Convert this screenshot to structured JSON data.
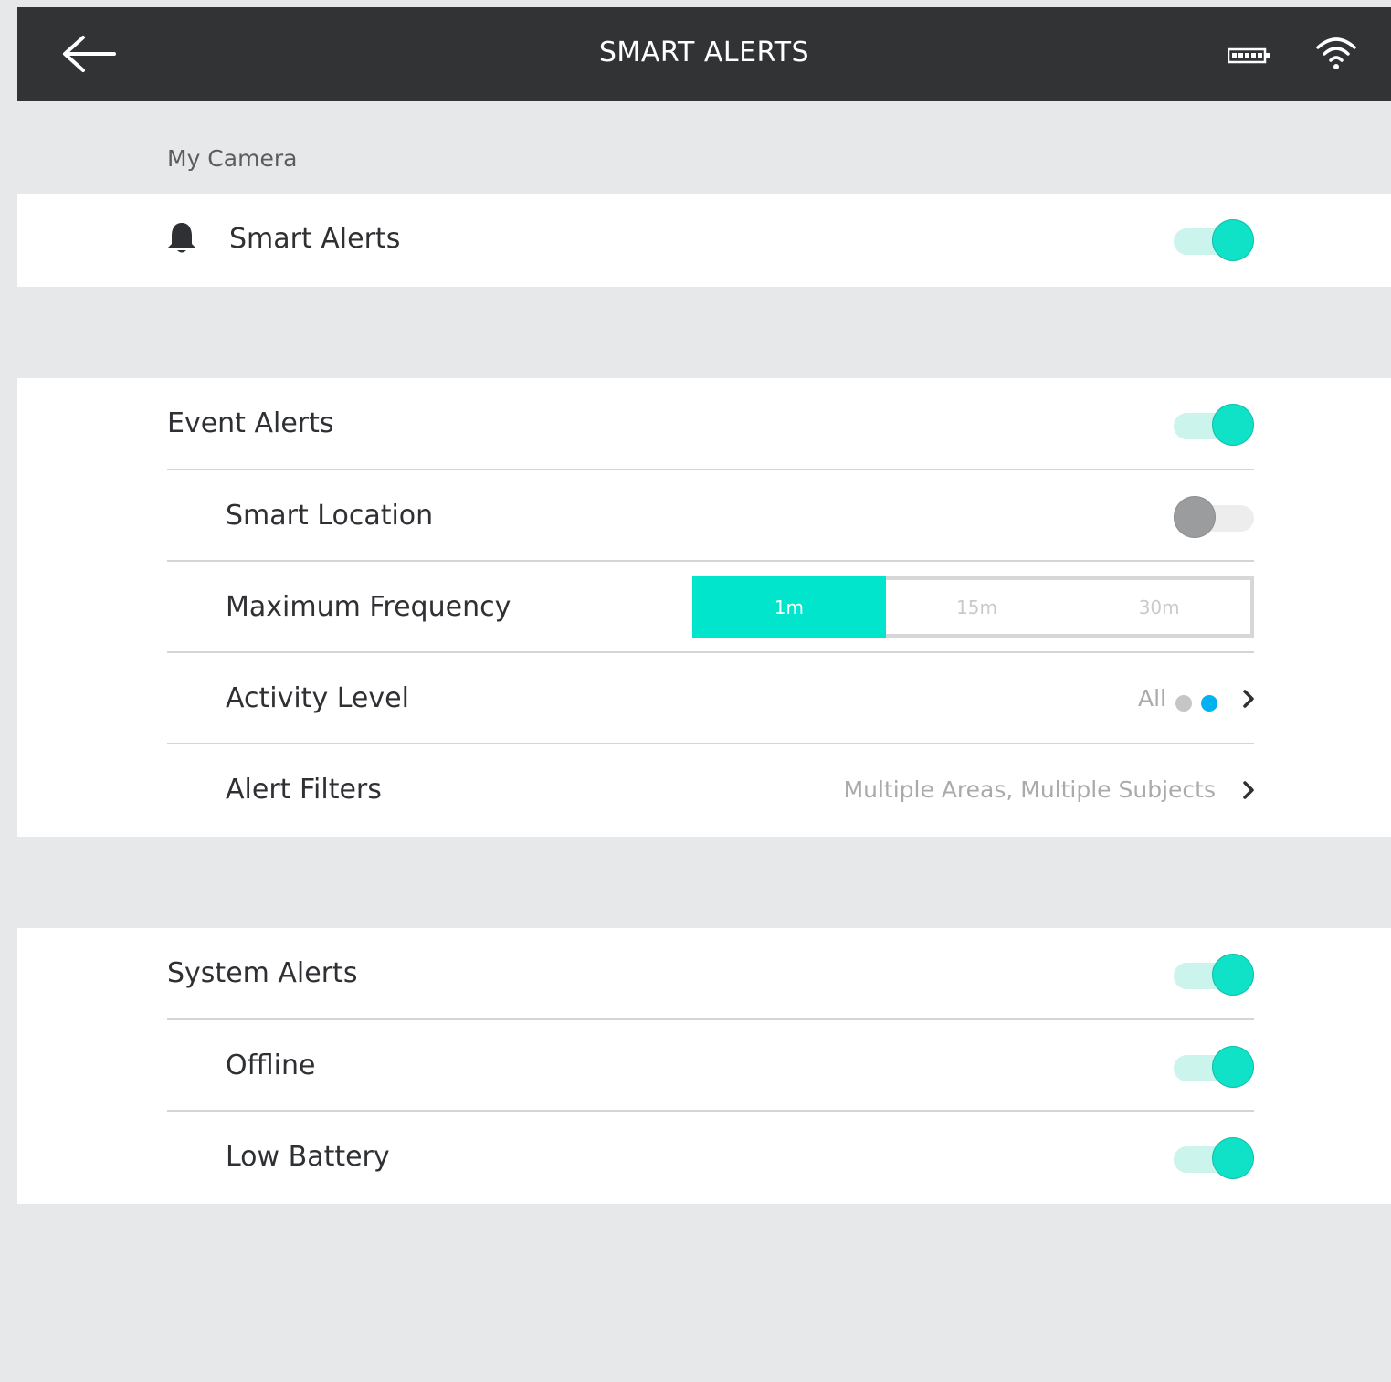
{
  "header": {
    "title": "SMART ALERTS",
    "back_icon": "arrow-left-icon",
    "battery_icon": "battery-icon",
    "wifi_icon": "wifi-icon"
  },
  "section": {
    "label": "My Camera"
  },
  "smart_alerts": {
    "label": "Smart Alerts",
    "icon": "bell-icon",
    "enabled": true
  },
  "event_alerts": {
    "label": "Event Alerts",
    "enabled": true,
    "smart_location": {
      "label": "Smart Location",
      "enabled": false
    },
    "maximum_frequency": {
      "label": "Maximum Frequency",
      "options": [
        "1m",
        "15m",
        "30m"
      ],
      "selected": "1m"
    },
    "activity_level": {
      "label": "Activity Level",
      "value": "All",
      "dot_colors": [
        "#c5c6c7",
        "#00b3f0"
      ]
    },
    "alert_filters": {
      "label": "Alert Filters",
      "value": "Multiple Areas, Multiple Subjects"
    }
  },
  "system_alerts": {
    "label": "System Alerts",
    "enabled": true,
    "offline": {
      "label": "Offline",
      "enabled": true
    },
    "low_battery": {
      "label": "Low Battery",
      "enabled": true
    }
  },
  "colors": {
    "accent": "#00e5cc",
    "header_bg": "#313335",
    "page_bg": "#e7e8e9"
  }
}
